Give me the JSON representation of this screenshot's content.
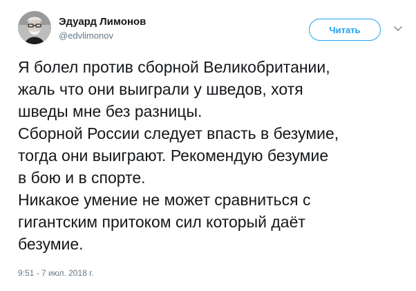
{
  "author": {
    "name": "Эдуард Лимонов",
    "handle": "@edvlimonov"
  },
  "actions": {
    "follow_label": "Читать",
    "menu_icon": "chevron-down-icon"
  },
  "tweet": {
    "lines": [
      "Я болел против сборной Великобритании,",
      "жаль что они выиграли у шведов, хотя",
      "шведы мне без разницы.",
      "Сборной России следует  впасть в безумие,",
      "тогда они выиграют. Рекомендую безумие",
      "в бою и в спорте.",
      "Никакое умение не может сравниться с",
      "гигантским притоком сил который даёт",
      "безумие."
    ],
    "timestamp": "9:51 - 7 июл. 2018 г."
  },
  "colors": {
    "accent": "#1da1f2",
    "text": "#14171a",
    "muted": "#657786"
  }
}
